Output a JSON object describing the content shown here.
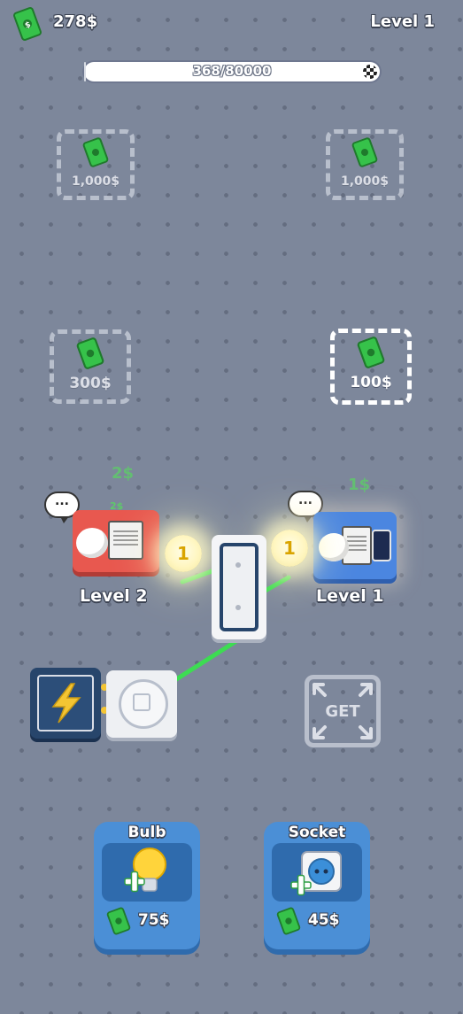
{
  "hud": {
    "money": "278$",
    "level": "Level 1",
    "progress_text": "368/80000",
    "progress_fraction": 0.0046
  },
  "slots": [
    {
      "price": "1,000$"
    },
    {
      "price": "1,000$"
    },
    {
      "price": "300$"
    },
    {
      "price": "100$"
    }
  ],
  "desks": [
    {
      "earn": "2$",
      "small_earn": "2$",
      "bubble": "...",
      "level": "Level 2",
      "bulb": "1",
      "color": "#e8584f"
    },
    {
      "earn": "1$",
      "bubble": "...",
      "level": "Level 1",
      "bulb": "1",
      "color": "#4b86e0"
    }
  ],
  "get_button": {
    "label": "GET"
  },
  "shop": {
    "bulb": {
      "title": "Bulb",
      "price": "75$"
    },
    "socket": {
      "title": "Socket",
      "price": "45$"
    }
  },
  "colors": {
    "background": "#7d879b",
    "cash_green": "#36c24a",
    "cable_green": "#3ddc52",
    "shop_blue": "#4b8fd6",
    "dark_blue": "#27456b"
  }
}
